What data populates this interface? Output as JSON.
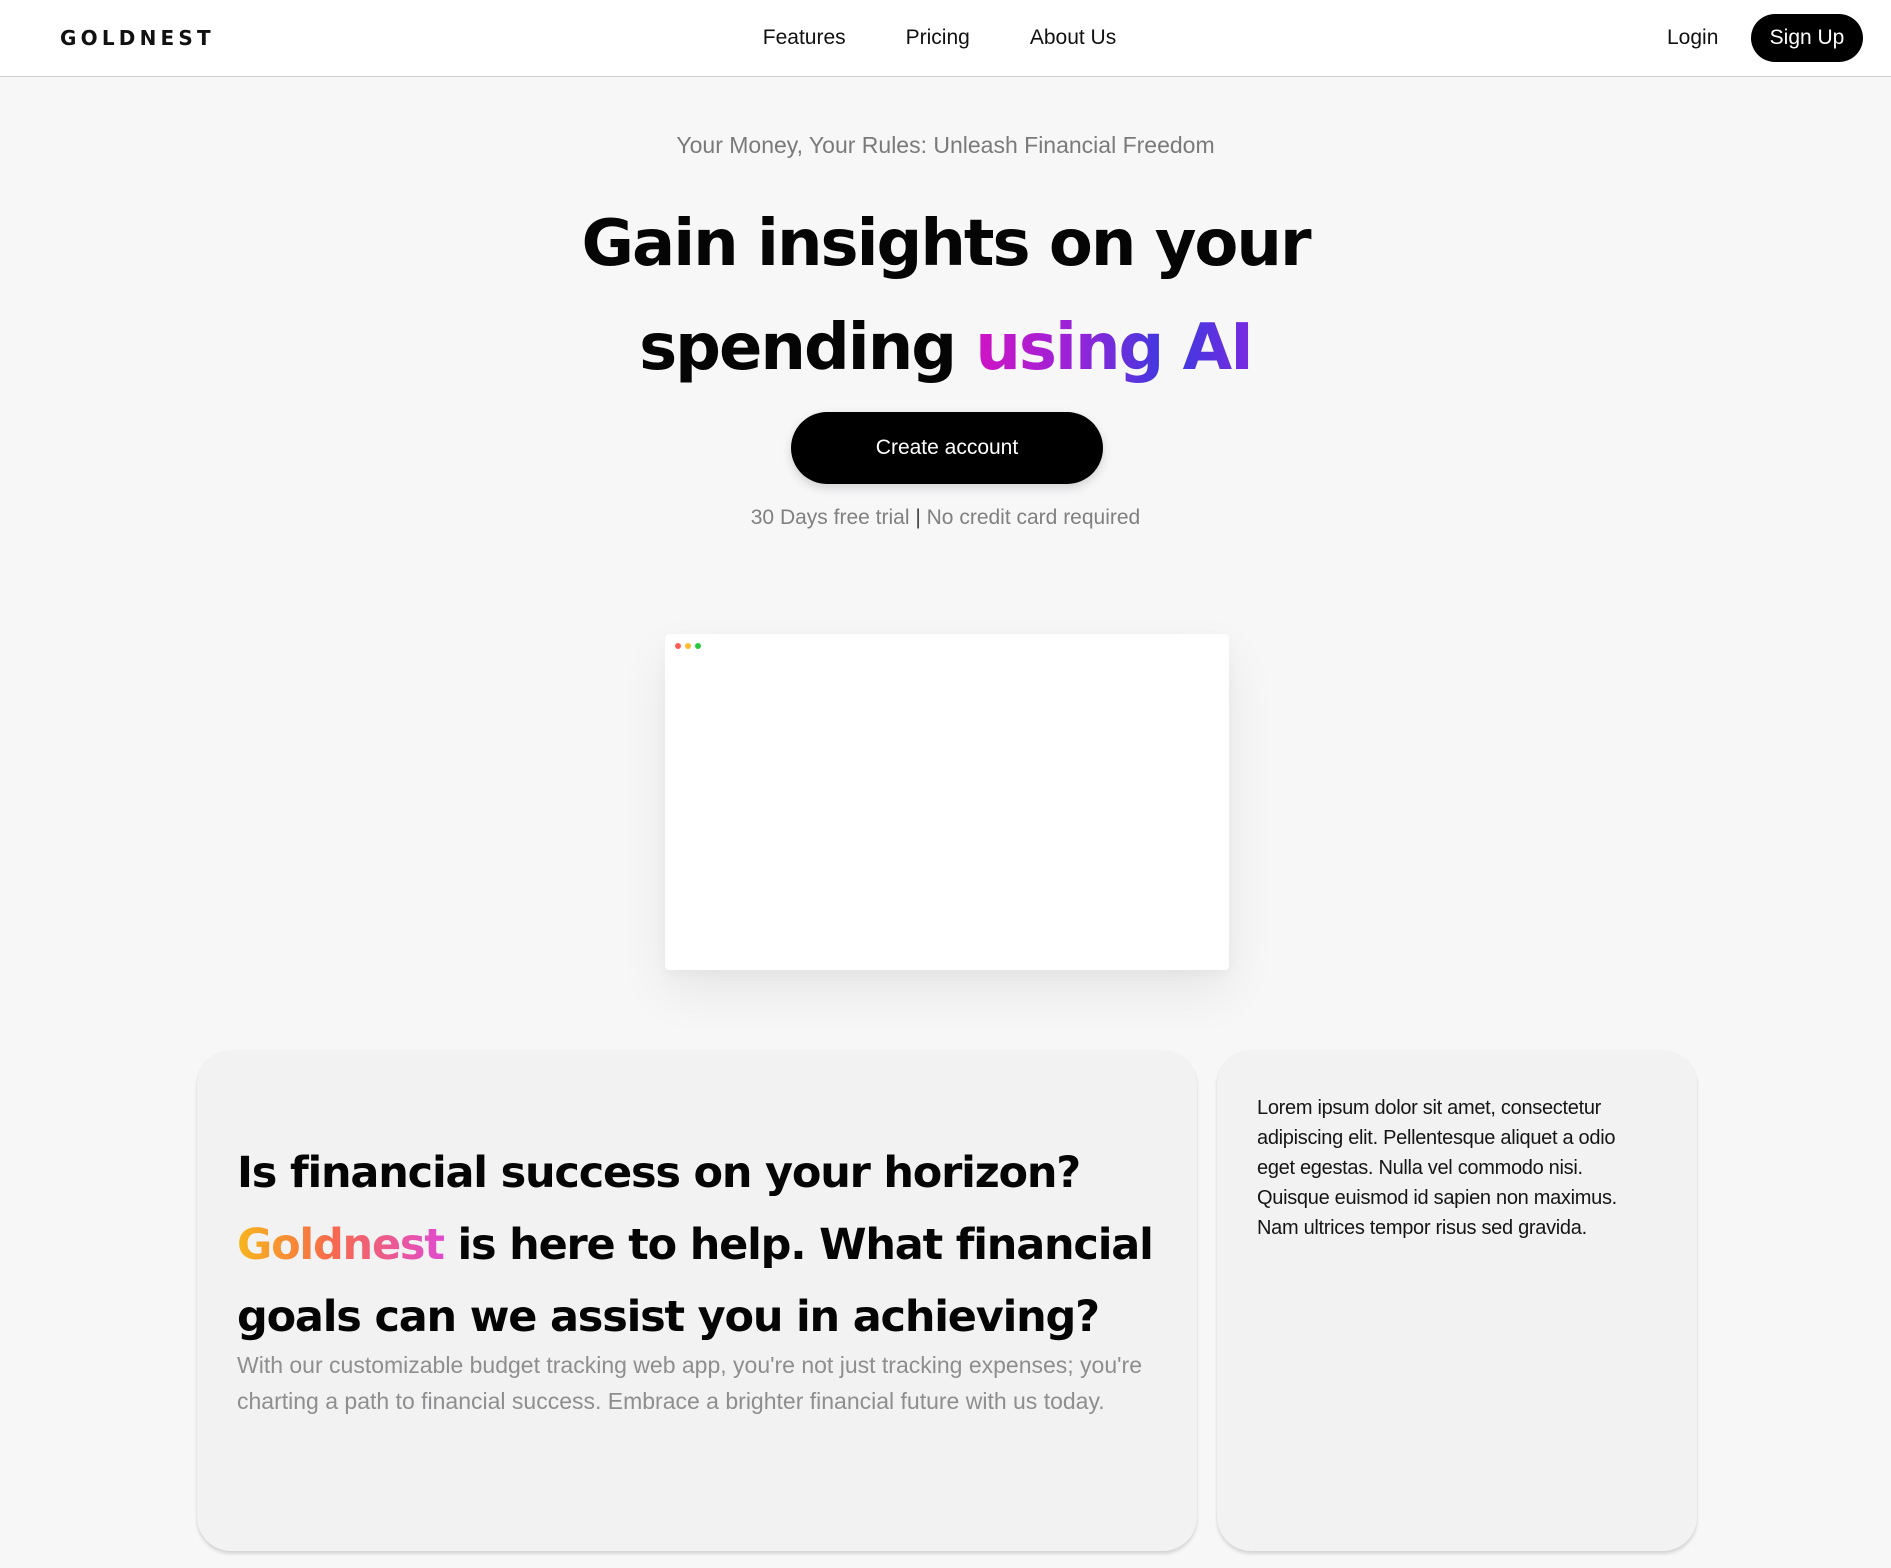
{
  "brand": {
    "logo_text": "GOLDNEST"
  },
  "nav": {
    "links": [
      {
        "label": "Features"
      },
      {
        "label": "Pricing"
      },
      {
        "label": "About Us"
      }
    ],
    "login_label": "Login",
    "signup_label": "Sign Up"
  },
  "hero": {
    "tagline": "Your Money, Your Rules: Unleash Financial Freedom",
    "headline_line1": "Gain insights on your",
    "headline_line2_plain": "spending",
    "headline_line2_gradient": "using AI",
    "cta_label": "Create account",
    "trial_left": "30 Days free trial",
    "trial_separator": "|",
    "trial_right": "No credit card required"
  },
  "preview": {
    "dot_colors": [
      "#ff5f57",
      "#febc2e",
      "#28c840"
    ]
  },
  "colors": {
    "ai_gradient": [
      "#d014c4",
      "#9a23d8",
      "#3a3ae0",
      "#7a2ae0"
    ],
    "brand_gradient": [
      "#f7b61c",
      "#f76a4a",
      "#e04bd0"
    ]
  },
  "feature_card": {
    "heading_line1": "Is financial success on your horizon?",
    "heading_brand": "Goldnest",
    "heading_rest": "is here to help. What financial goals can we assist you in achieving?",
    "body": "With our customizable budget tracking web app, you're not just tracking expenses; you're charting a path to financial success. Embrace a brighter financial future with us today."
  },
  "side_card": {
    "text": "Lorem ipsum dolor sit amet, consectetur adipiscing elit. Pellentesque aliquet a odio eget egestas. Nulla vel commodo nisi. Quisque euismod id sapien non maximus. Nam ultrices tempor risus sed gravida."
  }
}
